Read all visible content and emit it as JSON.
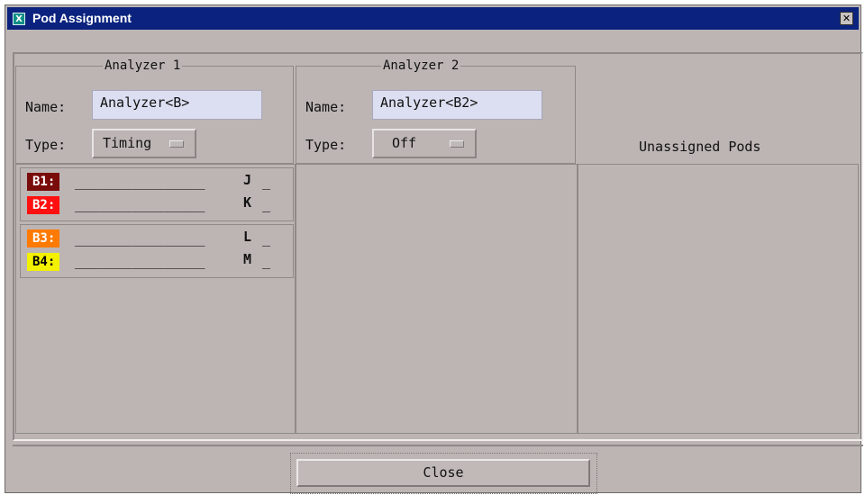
{
  "window": {
    "title": "Pod Assignment",
    "title_icon": "X",
    "close_glyph": "✕"
  },
  "analyzers": [
    {
      "title": "Analyzer 1",
      "name_label": "Name:",
      "name_value": "Analyzer<B>",
      "type_label": "Type:",
      "type_value": "Timing"
    },
    {
      "title": "Analyzer 2",
      "name_label": "Name:",
      "name_value": "Analyzer<B2>",
      "type_label": "Type:",
      "type_value": "Off"
    }
  ],
  "unassigned_title": "Unassigned Pods",
  "pods": {
    "groups": [
      {
        "rows": [
          {
            "label": "B1:",
            "line": "________________",
            "letter": "J",
            "trailing": "_",
            "bg": "#7a0b0b",
            "fg": "#ffffff"
          },
          {
            "label": "B2:",
            "line": "________________",
            "letter": "K",
            "trailing": "_",
            "bg": "#ff1010",
            "fg": "#ffffff"
          }
        ]
      },
      {
        "rows": [
          {
            "label": "B3:",
            "line": "________________",
            "letter": "L",
            "trailing": "_",
            "bg": "#ff7a00",
            "fg": "#ffffff"
          },
          {
            "label": "B4:",
            "line": "________________",
            "letter": "M",
            "trailing": "_",
            "bg": "#f3f000",
            "fg": "#000000"
          }
        ]
      }
    ]
  },
  "footer": {
    "close_label": "Close"
  },
  "colors": {
    "titlebar": "#0b237e",
    "background": "#bcb5b4",
    "input": "#dcdff1"
  }
}
